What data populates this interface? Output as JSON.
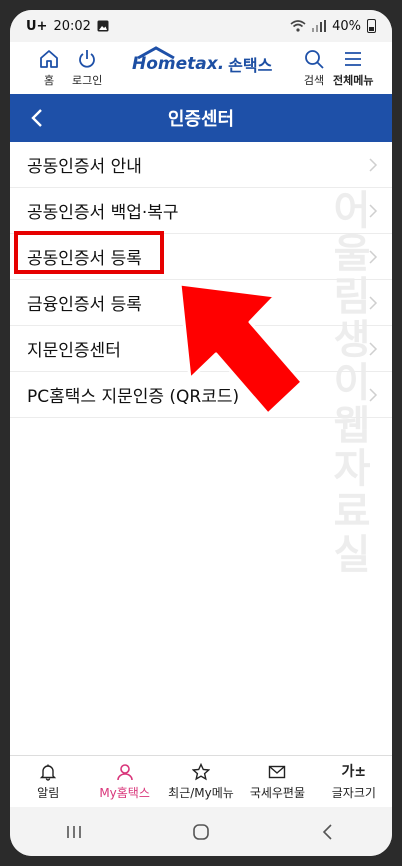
{
  "status": {
    "carrier": "U+",
    "time": "20:02",
    "battery": "40%"
  },
  "header": {
    "home_label": "홈",
    "login_label": "로그인",
    "logo_text": "Hometax.",
    "logo_ko": "손택스",
    "search_label": "검색",
    "menu_label": "전체메뉴"
  },
  "title": "인증센터",
  "menu_items": [
    {
      "label": "공동인증서 안내"
    },
    {
      "label": "공동인증서 백업·복구"
    },
    {
      "label": "공동인증서 등록"
    },
    {
      "label": "금융인증서 등록"
    },
    {
      "label": "지문인증센터"
    },
    {
      "label": "PC홈택스 지문인증 (QR코드)"
    }
  ],
  "watermark": "어울림생이웹자료실",
  "bottom_tabs": [
    {
      "label": "알림",
      "icon": "bell-icon"
    },
    {
      "label": "My홈택스",
      "icon": "person-icon"
    },
    {
      "label": "최근/My메뉴",
      "icon": "star-icon"
    },
    {
      "label": "국세우편물",
      "icon": "mail-icon"
    },
    {
      "label": "글자크기",
      "icon": "text-size-icon",
      "glyph": "가±"
    }
  ],
  "colors": {
    "primary": "#1e50a8",
    "active_tab": "#d9357a",
    "annotation": "#e60000"
  }
}
